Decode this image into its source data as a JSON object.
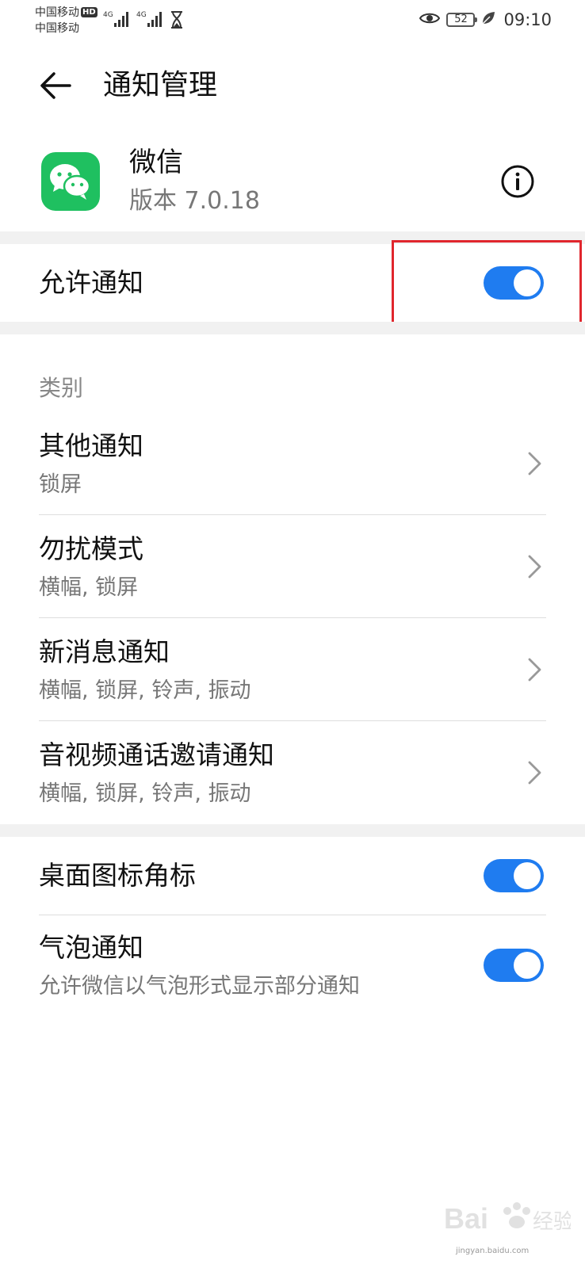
{
  "status_bar": {
    "carrier_1": "中国移动",
    "carrier_1_badge": "HD",
    "carrier_2": "中国移动",
    "signal_1_label": "4G",
    "signal_2_label": "4G",
    "battery_level": "52",
    "time": "09:10"
  },
  "header": {
    "title": "通知管理",
    "back_icon": "arrow-left-icon"
  },
  "app": {
    "name": "微信",
    "version": "版本 7.0.18",
    "icon": "wechat-icon",
    "info_icon": "info-circle-icon"
  },
  "allow_notifications": {
    "label": "允许通知",
    "enabled": true
  },
  "category": {
    "label": "类别",
    "items": [
      {
        "title": "其他通知",
        "subtitle": "锁屏"
      },
      {
        "title": "勿扰模式",
        "subtitle": "横幅, 锁屏"
      },
      {
        "title": "新消息通知",
        "subtitle": "横幅, 锁屏, 铃声, 振动"
      },
      {
        "title": "音视频通话邀请通知",
        "subtitle": "横幅, 锁屏, 铃声, 振动"
      }
    ]
  },
  "badge_setting": {
    "label": "桌面图标角标",
    "enabled": true
  },
  "bubble_setting": {
    "label": "气泡通知",
    "subtitle": "允许微信以气泡形式显示部分通知",
    "enabled": true
  },
  "watermark": {
    "text": "jingyan.baidu.com"
  },
  "colors": {
    "accent": "#1f7cf0",
    "wechat_green": "#1fc060",
    "highlight": "#e0262d",
    "section_gap": "#f1f1f1"
  }
}
